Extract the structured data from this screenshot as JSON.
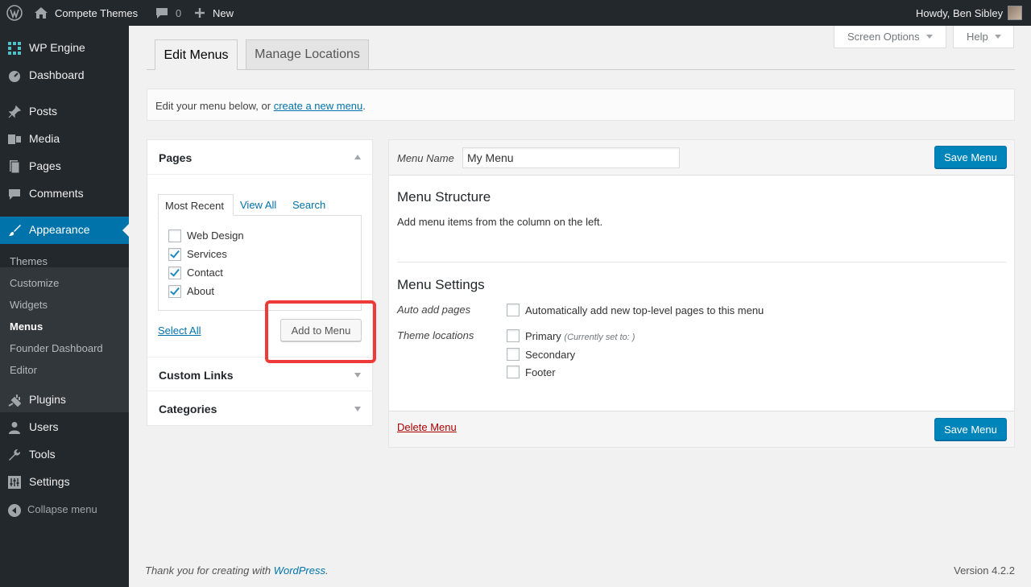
{
  "adminbar": {
    "site_name": "Compete Themes",
    "comments_count": "0",
    "new_label": "New",
    "howdy": "Howdy, Ben Sibley"
  },
  "sidebar": {
    "items": [
      {
        "label": "WP Engine",
        "icon": "grid-icon"
      },
      {
        "label": "Dashboard",
        "icon": "dashboard-icon"
      },
      {
        "label": "Posts",
        "icon": "pin-icon"
      },
      {
        "label": "Media",
        "icon": "media-icon"
      },
      {
        "label": "Pages",
        "icon": "pages-icon"
      },
      {
        "label": "Comments",
        "icon": "comment-icon"
      },
      {
        "label": "Appearance",
        "icon": "brush-icon"
      },
      {
        "label": "Plugins",
        "icon": "plug-icon"
      },
      {
        "label": "Users",
        "icon": "user-icon"
      },
      {
        "label": "Tools",
        "icon": "wrench-icon"
      },
      {
        "label": "Settings",
        "icon": "settings-icon"
      },
      {
        "label": "Collapse menu",
        "icon": "collapse-icon"
      }
    ],
    "submenu": [
      "Themes",
      "Customize",
      "Widgets",
      "Menus",
      "Founder Dashboard",
      "Editor"
    ]
  },
  "top_buttons": {
    "screen_options": "Screen Options",
    "help": "Help"
  },
  "tabs": {
    "edit_menus": "Edit Menus",
    "manage_locations": "Manage Locations"
  },
  "notice": {
    "text": "Edit your menu below, or ",
    "link": "create a new menu",
    "end": "."
  },
  "pages_panel": {
    "title": "Pages",
    "tabs": [
      "Most Recent",
      "View All",
      "Search"
    ],
    "items": [
      {
        "label": "Web Design",
        "checked": false
      },
      {
        "label": "Services",
        "checked": true
      },
      {
        "label": "Contact",
        "checked": true
      },
      {
        "label": "About",
        "checked": true
      }
    ],
    "select_all": "Select All",
    "add_button": "Add to Menu"
  },
  "accordion": {
    "custom_links": "Custom Links",
    "categories": "Categories"
  },
  "menu_editor": {
    "name_label": "Menu Name",
    "name_value": "My Menu",
    "save_label": "Save Menu",
    "structure_title": "Menu Structure",
    "structure_desc": "Add menu items from the column on the left.",
    "settings_title": "Menu Settings",
    "auto_add_label": "Auto add pages",
    "auto_add_text": "Automatically add new top-level pages to this menu",
    "theme_locations_label": "Theme locations",
    "locations": [
      {
        "label": "Primary",
        "note": "(Currently set to: )"
      },
      {
        "label": "Secondary",
        "note": ""
      },
      {
        "label": "Footer",
        "note": ""
      }
    ],
    "delete_label": "Delete Menu"
  },
  "footer": {
    "thanks_text": "Thank you for creating with ",
    "thanks_link": "WordPress",
    "thanks_end": ".",
    "version": "Version 4.2.2"
  },
  "colors": {
    "admin_dark": "#23282d",
    "accent": "#0073aa",
    "highlight": "#ef3a3a",
    "primary_button": "#0085ba"
  }
}
